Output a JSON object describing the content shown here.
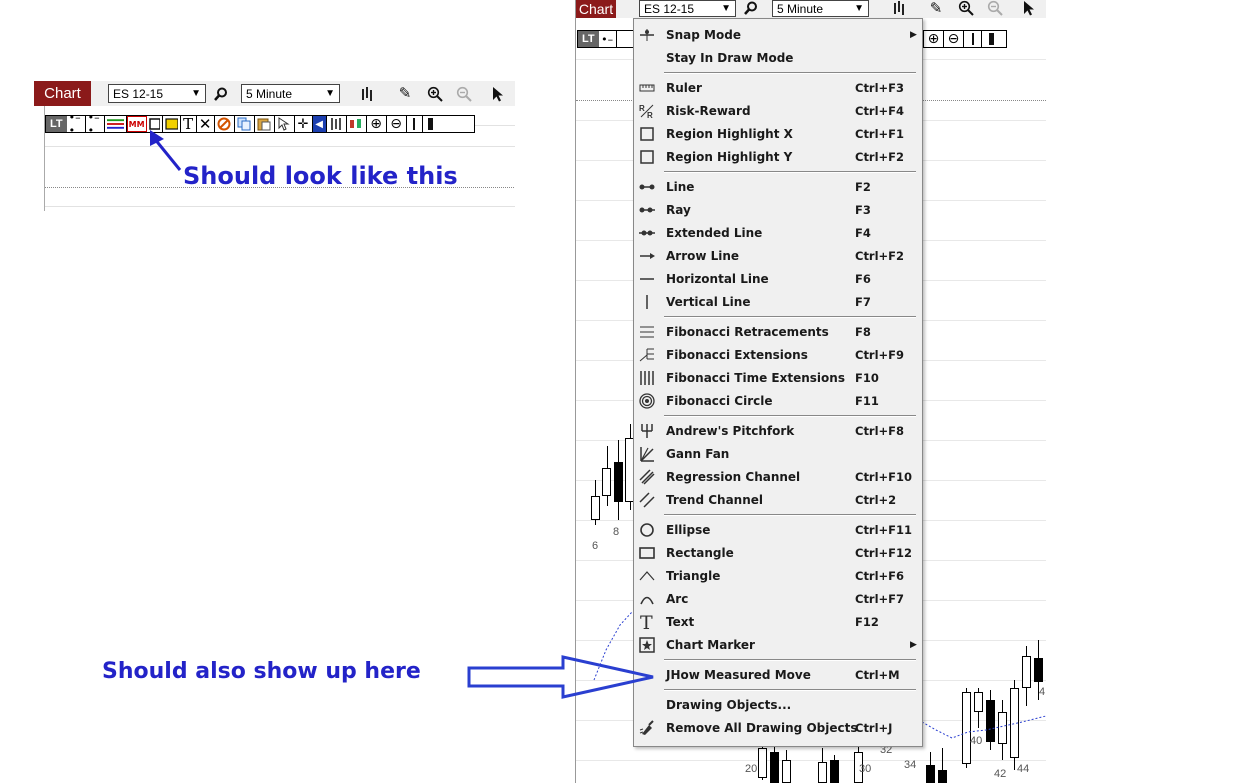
{
  "small_chart": {
    "tab_label": "Chart",
    "symbol": "ES 12-15",
    "interval": "5 Minute",
    "lt_label": "LT",
    "mm_label": "MM",
    "text_tool_label": "T",
    "annotation": "Should look like this"
  },
  "big_chart": {
    "tab_label": "Chart",
    "symbol": "ES 12-15",
    "interval": "5 Minute",
    "lt_label": "LT",
    "axis_labels": [
      "6",
      "8",
      "20",
      "30",
      "32",
      "34",
      "40",
      "42",
      "44",
      "4"
    ]
  },
  "annotation_bottom": "Should also show up here",
  "menu": {
    "items": [
      {
        "label": "Snap Mode",
        "shortcut": "",
        "icon": "snap-icon",
        "submenu": true
      },
      {
        "label": "Stay In Draw Mode",
        "shortcut": "",
        "icon": "",
        "submenu": false
      },
      {
        "label": "Ruler",
        "shortcut": "Ctrl+F3",
        "icon": "ruler-icon"
      },
      {
        "label": "Risk-Reward",
        "shortcut": "Ctrl+F4",
        "icon": "risk-reward-icon"
      },
      {
        "label": "Region Highlight X",
        "shortcut": "Ctrl+F1",
        "icon": "region-x-icon"
      },
      {
        "label": "Region Highlight Y",
        "shortcut": "Ctrl+F2",
        "icon": "region-y-icon"
      },
      {
        "label": "Line",
        "shortcut": "F2",
        "icon": "line-icon"
      },
      {
        "label": "Ray",
        "shortcut": "F3",
        "icon": "ray-icon"
      },
      {
        "label": "Extended Line",
        "shortcut": "F4",
        "icon": "extended-line-icon"
      },
      {
        "label": "Arrow Line",
        "shortcut": "Ctrl+F2",
        "icon": "arrow-line-icon"
      },
      {
        "label": "Horizontal Line",
        "shortcut": "F6",
        "icon": "horizontal-line-icon"
      },
      {
        "label": "Vertical Line",
        "shortcut": "F7",
        "icon": "vertical-line-icon"
      },
      {
        "label": "Fibonacci Retracements",
        "shortcut": "F8",
        "icon": "fib-retracement-icon"
      },
      {
        "label": "Fibonacci Extensions",
        "shortcut": "Ctrl+F9",
        "icon": "fib-extension-icon"
      },
      {
        "label": "Fibonacci Time Extensions",
        "shortcut": "F10",
        "icon": "fib-time-icon"
      },
      {
        "label": "Fibonacci Circle",
        "shortcut": "F11",
        "icon": "fib-circle-icon"
      },
      {
        "label": "Andrew's Pitchfork",
        "shortcut": "Ctrl+F8",
        "icon": "pitchfork-icon"
      },
      {
        "label": "Gann Fan",
        "shortcut": "",
        "icon": "gann-fan-icon"
      },
      {
        "label": "Regression Channel",
        "shortcut": "Ctrl+F10",
        "icon": "regression-channel-icon"
      },
      {
        "label": "Trend Channel",
        "shortcut": "Ctrl+2",
        "icon": "trend-channel-icon"
      },
      {
        "label": "Ellipse",
        "shortcut": "Ctrl+F11",
        "icon": "ellipse-icon"
      },
      {
        "label": "Rectangle",
        "shortcut": "Ctrl+F12",
        "icon": "rectangle-icon"
      },
      {
        "label": "Triangle",
        "shortcut": "Ctrl+F6",
        "icon": "triangle-icon"
      },
      {
        "label": "Arc",
        "shortcut": "Ctrl+F7",
        "icon": "arc-icon"
      },
      {
        "label": "Text",
        "shortcut": "F12",
        "icon": "text-icon"
      },
      {
        "label": "Chart Marker",
        "shortcut": "",
        "icon": "chart-marker-icon",
        "submenu": true
      },
      {
        "label": "JHow Measured Move",
        "shortcut": "Ctrl+M",
        "icon": ""
      },
      {
        "label": "Drawing Objects...",
        "shortcut": "",
        "icon": ""
      },
      {
        "label": "Remove All Drawing Objects",
        "shortcut": "Ctrl+J",
        "icon": "remove-all-icon"
      }
    ]
  },
  "colors": {
    "chart_tab": "#8b1a1a",
    "annotation": "#2323c8",
    "menu_bg": "#f0f0f0"
  }
}
